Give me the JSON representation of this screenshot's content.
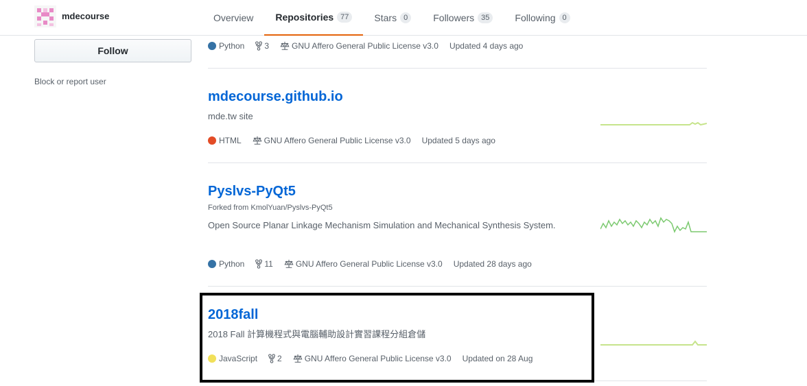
{
  "profile": {
    "username": "mdecourse",
    "follow_label": "Follow",
    "block_label": "Block or report user"
  },
  "tabs": [
    {
      "label": "Overview",
      "count": ""
    },
    {
      "label": "Repositories",
      "count": "77"
    },
    {
      "label": "Stars",
      "count": "0"
    },
    {
      "label": "Followers",
      "count": "35"
    },
    {
      "label": "Following",
      "count": "0"
    }
  ],
  "colors": {
    "python": "#3572A5",
    "html": "#e34c26",
    "javascript": "#f1e05a",
    "link": "#0366d6",
    "tab_underline": "#e36209",
    "sparkline": "#c6e48b"
  },
  "repos": [
    {
      "name": "",
      "language": "Python",
      "forks": "3",
      "license": "GNU Affero General Public License v3.0",
      "updated": "Updated 4 days ago"
    },
    {
      "name": "mdecourse.github.io",
      "description": "mde.tw site",
      "language": "HTML",
      "license": "GNU Affero General Public License v3.0",
      "updated": "Updated 5 days ago"
    },
    {
      "name": "Pyslvs-PyQt5",
      "fork_prefix": "Forked from ",
      "fork_source": "KmolYuan/Pyslvs-PyQt5",
      "description": "Open Source Planar Linkage Mechanism Simulation and Mechanical Synthesis System.",
      "language": "Python",
      "forks": "11",
      "license": "GNU Affero General Public License v3.0",
      "updated": "Updated 28 days ago"
    },
    {
      "name": "2018fall",
      "description": "2018 Fall 計算機程式與電腦輔助設計實習課程分組倉儲",
      "language": "JavaScript",
      "forks": "2",
      "license": "GNU Affero General Public License v3.0",
      "updated": "Updated on 28 Aug"
    }
  ]
}
